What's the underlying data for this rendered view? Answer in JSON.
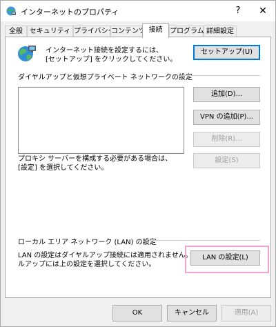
{
  "window": {
    "title": "インターネットのプロパティ",
    "help": "?",
    "close": "✕"
  },
  "tabs": [
    {
      "label": "全般"
    },
    {
      "label": "セキュリティ"
    },
    {
      "label": "プライバシー"
    },
    {
      "label": "コンテンツ"
    },
    {
      "label": "接続"
    },
    {
      "label": "プログラム"
    },
    {
      "label": "詳細設定"
    }
  ],
  "setup": {
    "text_line1": "インターネット接続を設定するには、",
    "text_line2": "[セットアップ] をクリックしてください。",
    "button": "セットアップ(U)"
  },
  "dialup": {
    "group_label": "ダイヤルアップと仮想プライベート ネットワークの設定",
    "add": "追加(D)...",
    "add_vpn": "VPN の追加(P)...",
    "remove": "削除(R)...",
    "settings": "設定(S)",
    "proxy_line1": "プロキシ サーバーを構成する必要がある場合は、",
    "proxy_line2": "[設定] を選択してください。"
  },
  "lan": {
    "group_label": "ローカル エリア ネットワーク (LAN) の設定",
    "text_line1": "LAN の設定はダイヤルアップ接続には適用されません。ダイヤ",
    "text_line2": "ルアップには上の設定を選択してください。",
    "button": "LAN の設定(L)"
  },
  "footer": {
    "ok": "OK",
    "cancel": "キャンセル",
    "apply": "適用(A)"
  },
  "colors": {
    "highlight": "#f0a6cc",
    "focus_border": "#0078d7"
  }
}
